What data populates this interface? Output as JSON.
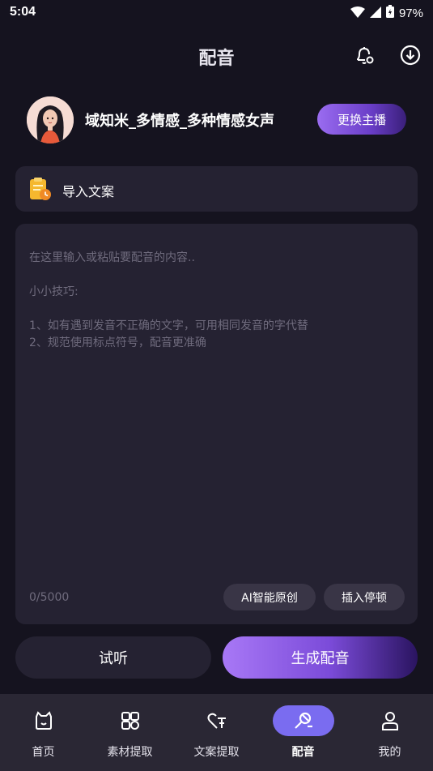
{
  "status_bar": {
    "time": "5:04",
    "battery": "97%"
  },
  "header": {
    "title": "配音"
  },
  "voice": {
    "name": "域知米_多情感_多种情感女声",
    "change_label": "更换主播"
  },
  "import": {
    "label": "导入文案"
  },
  "editor": {
    "placeholder_line": "在这里输入或粘贴要配音的内容..",
    "tips_title": "小小技巧:",
    "tip1": "1、如有遇到发音不正确的文字，可用相同发音的字代替",
    "tip2": "2、规范使用标点符号，配音更准确",
    "char_count": "0/5000",
    "ai_button": "AI智能原创",
    "pause_button": "插入停顿"
  },
  "actions": {
    "listen": "试听",
    "generate": "生成配音"
  },
  "nav": {
    "items": [
      {
        "label": "首页",
        "icon": "home-icon"
      },
      {
        "label": "素材提取",
        "icon": "material-icon"
      },
      {
        "label": "文案提取",
        "icon": "copy-extract-icon"
      },
      {
        "label": "配音",
        "icon": "dubbing-icon",
        "active": true
      },
      {
        "label": "我的",
        "icon": "profile-icon"
      }
    ]
  },
  "colors": {
    "accent": "#7a6cf0",
    "background": "#15131f",
    "card": "#252232"
  }
}
